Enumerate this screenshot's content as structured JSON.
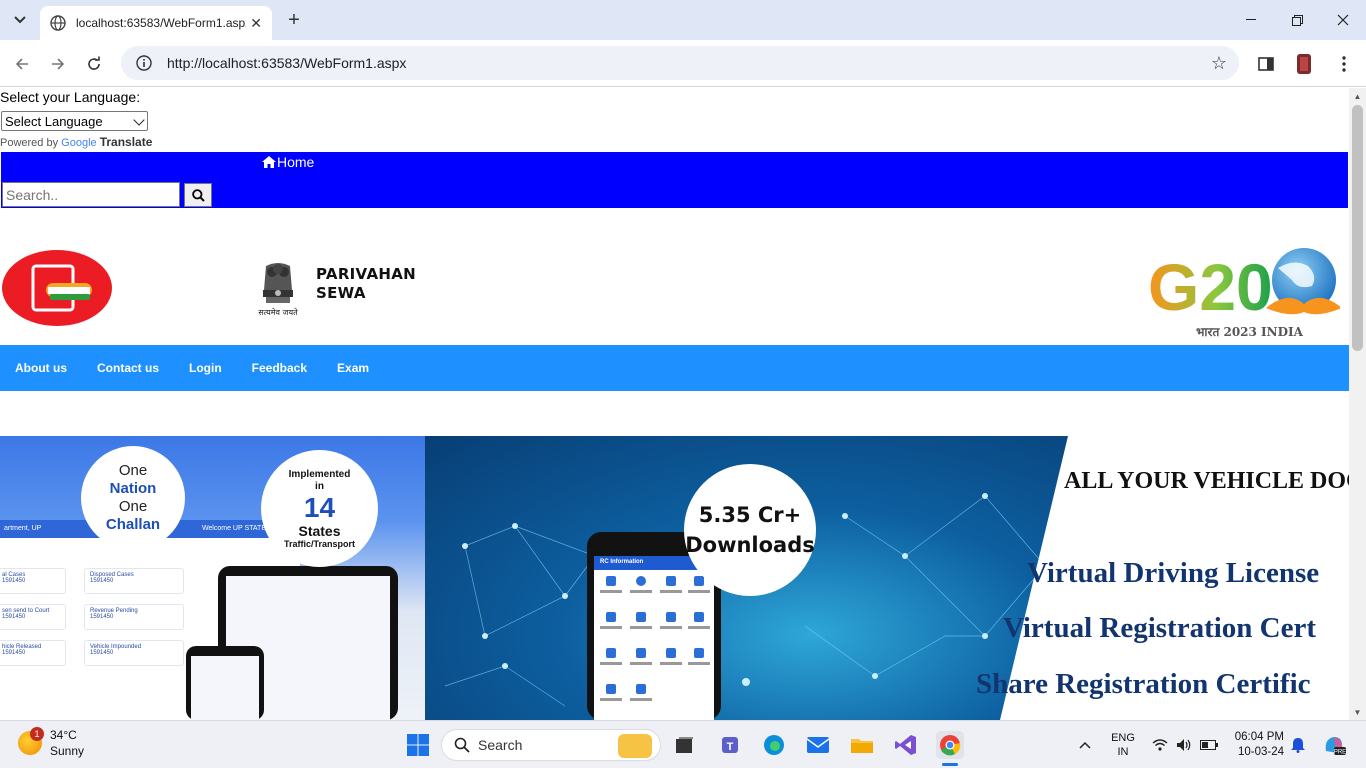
{
  "browser": {
    "tab_title": "localhost:63583/WebForm1.aspx",
    "url": "http://localhost:63583/WebForm1.aspx"
  },
  "page": {
    "language_label": "Select your Language:",
    "language_select_value": "Select Language",
    "powered_by": "Powered by",
    "google_text": "Google",
    "translate_text": "Translate",
    "home_link": "Home",
    "search_placeholder": "Search..",
    "brand_line1": "PARIVAHAN",
    "brand_line2": "SEWA",
    "emblem_caption": "सत्यमेव जयते",
    "g20_text": "G20",
    "g20_caption": "भारत 2023 INDIA",
    "menu": [
      "About us",
      "Contact us",
      "Login",
      "Feedback",
      "Exam"
    ]
  },
  "banner": {
    "circle1": [
      "One",
      "Nation",
      "One",
      "Challan"
    ],
    "circle2": {
      "line1": "Implemented",
      "line2": "in",
      "number": "14",
      "line3": "States",
      "line4": "Traffic/Transport"
    },
    "circle3": [
      "5.35 Cr+",
      "Downloads"
    ],
    "right_title": "ALL YOUR VEHICLE DOC",
    "right_lines": [
      "Virtual Driving License",
      "Virtual Registration Cert",
      "Share Registration Certific"
    ],
    "dash_header": "artment, UP",
    "dash_welcome": "Welcome UP STATE",
    "tiles": [
      "al Cases",
      "Disposed Cases",
      "sen send to Court",
      "Revenue Pending",
      "hicle Released",
      "Vehicle Impounded"
    ],
    "tile_value": "1591450",
    "phone_header": "RC Information"
  },
  "taskbar": {
    "weather_temp": "34°C",
    "weather_desc": "Sunny",
    "weather_badge": "1",
    "search_label": "Search",
    "lang_line1": "ENG",
    "lang_line2": "IN",
    "time": "06:04 PM",
    "date": "10-03-24"
  }
}
